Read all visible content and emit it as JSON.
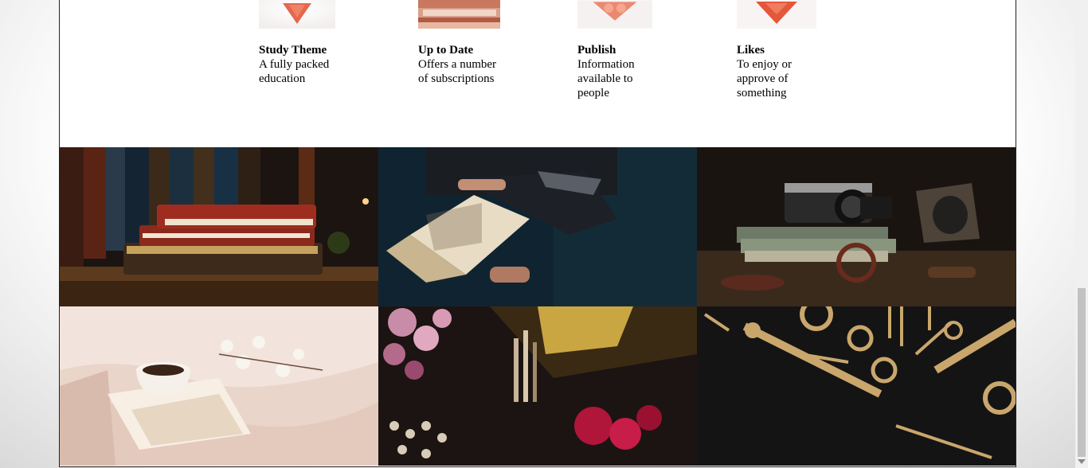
{
  "features": [
    {
      "title": "Study Theme",
      "description": "A fully packed education",
      "icon": "heart-thumbnail-icon"
    },
    {
      "title": "Up to Date",
      "description": "Offers a number of subscriptions",
      "icon": "book-thumbnail-icon"
    },
    {
      "title": "Publish",
      "description": "Information available to people",
      "icon": "heart-thumbnail-icon"
    },
    {
      "title": "Likes",
      "description": "To enjoy or approve of something",
      "icon": "heart-thumbnail-icon"
    }
  ],
  "gallery": [
    {
      "subject": "stacked-leather-books"
    },
    {
      "subject": "person-reading-book"
    },
    {
      "subject": "vintage-camera-still-life"
    },
    {
      "subject": "coffee-cup-on-book"
    },
    {
      "subject": "flowers-and-paintbrushes"
    },
    {
      "subject": "golden-tools-flatlay"
    }
  ],
  "colors": {
    "accent": "#e3573a",
    "frame": "#222222",
    "scroll_thumb": "#c2c2c2"
  }
}
